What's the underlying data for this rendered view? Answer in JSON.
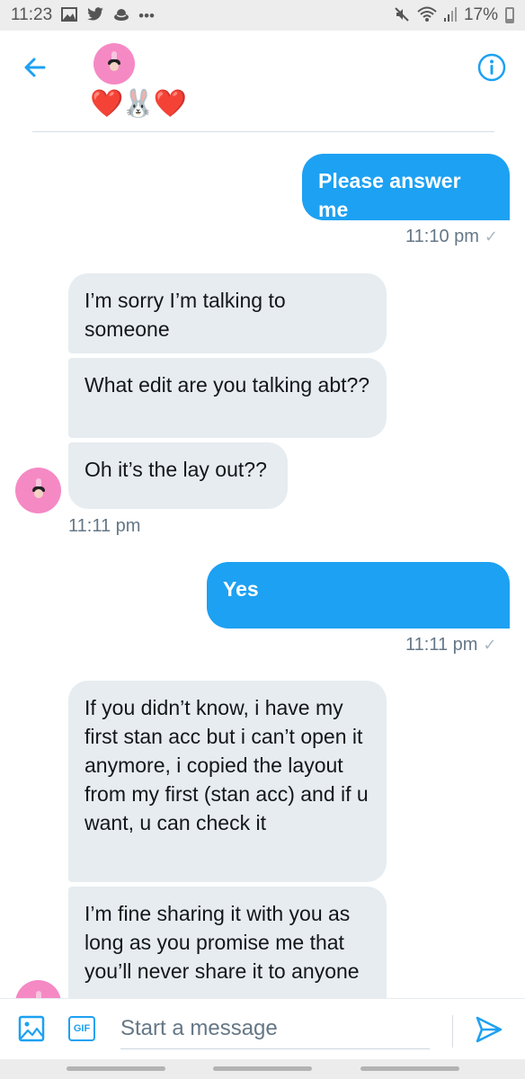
{
  "status_bar": {
    "time": "11:23",
    "notification_icons": [
      "gallery-icon",
      "twitter-icon",
      "hat-icon",
      "more-icon"
    ],
    "system_icons": [
      "mute-icon",
      "wifi-icon",
      "signal-icon"
    ],
    "battery": "17%",
    "battery_level": 0.17
  },
  "header": {
    "back_icon": "arrow-left-icon",
    "contact_name": "❤️🐰❤️",
    "info_icon": "info-icon"
  },
  "messages": [
    {
      "direction": "outgoing",
      "text": "Please answer me"
    },
    {
      "direction": "incoming",
      "text": "I’m sorry I’m talking to someone"
    },
    {
      "direction": "incoming",
      "text": "What edit are you talking abt??"
    },
    {
      "direction": "incoming",
      "text": "Oh it’s the lay out??"
    },
    {
      "direction": "outgoing",
      "text": "Yes"
    },
    {
      "direction": "incoming",
      "text": "If you didn’t know, i have my first stan acc but i can’t open it anymore, i copied the layout from my first (stan acc) and if u want, u can check it"
    },
    {
      "direction": "incoming",
      "text": "I’m fine sharing it with you as long as you promise me that you’ll never share it to anyone"
    }
  ],
  "timestamps": [
    {
      "text": "11:10 pm",
      "check": "✓"
    },
    {
      "text": "11:11 pm"
    },
    {
      "text": "11:11 pm",
      "check": "✓"
    }
  ],
  "composer": {
    "image_icon": "image-icon",
    "gif_label": "GIF",
    "placeholder": "Start a message",
    "value": "",
    "send_icon": "send-icon"
  },
  "colors": {
    "accent": "#1da1f2",
    "incoming_bubble": "#e6ecf0",
    "avatar_bg": "#f589c4",
    "timestamp": "#657786"
  }
}
